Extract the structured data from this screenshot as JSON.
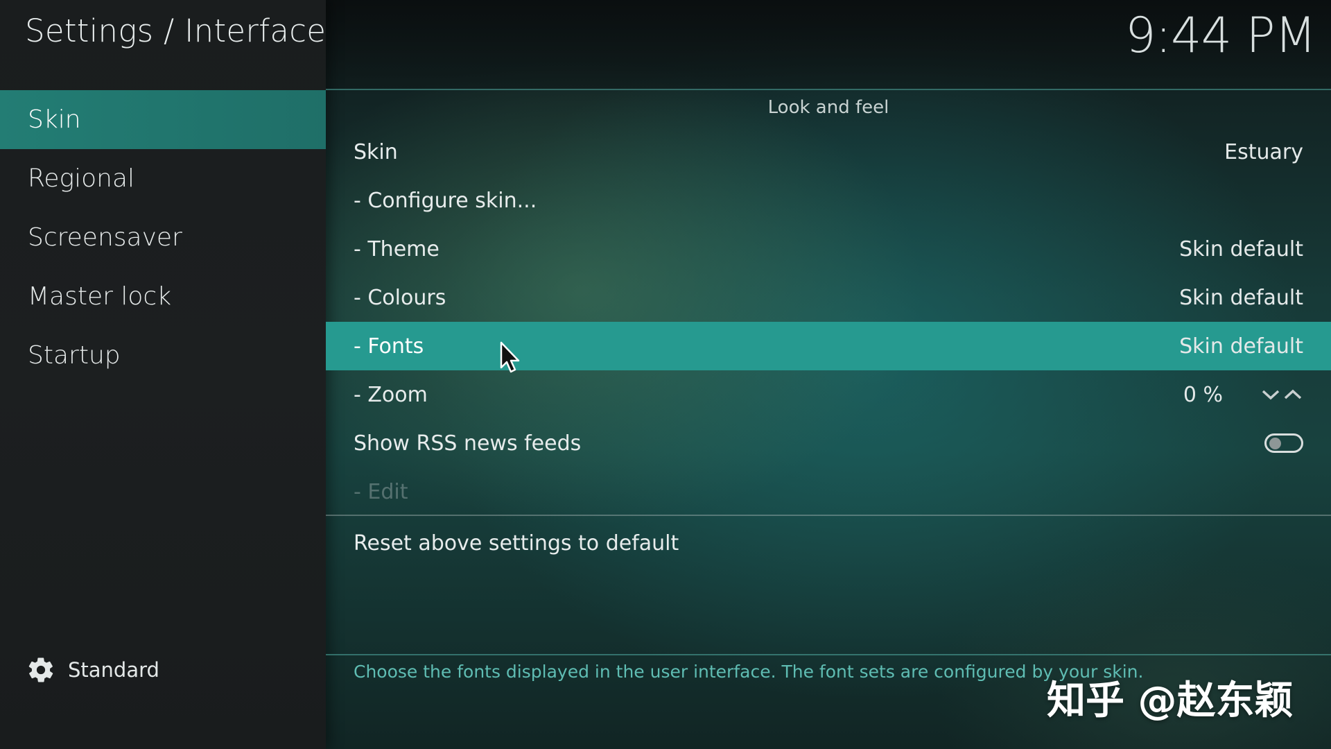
{
  "header": {
    "title": "Settings / Interface",
    "clock": "9:44 PM"
  },
  "sidebar": {
    "items": [
      {
        "label": "Skin",
        "active": true
      },
      {
        "label": "Regional"
      },
      {
        "label": "Screensaver"
      },
      {
        "label": "Master lock"
      },
      {
        "label": "Startup"
      }
    ],
    "footer": {
      "label": "Standard",
      "icon": "gear-icon"
    }
  },
  "main": {
    "section_header": "Look and feel",
    "rows": [
      {
        "label": "Skin",
        "value": "Estuary"
      },
      {
        "label": "- Configure skin...",
        "value": ""
      },
      {
        "label": "- Theme",
        "value": "Skin default"
      },
      {
        "label": "- Colours",
        "value": "Skin default"
      },
      {
        "label": "- Fonts",
        "value": "Skin default",
        "selected": true
      },
      {
        "label": "- Zoom",
        "value": "0 %",
        "controls": [
          "chevron-down-icon",
          "chevron-up-icon"
        ]
      },
      {
        "label": "Show RSS news feeds",
        "toggle": false
      },
      {
        "label": "- Edit",
        "disabled": true
      }
    ],
    "reset_label": "Reset above settings to default",
    "help_text": "Choose the fonts displayed in the user interface. The font sets are configured by your skin."
  },
  "watermark": "知乎 @赵东颖",
  "colors": {
    "accent": "#269a90",
    "sidebar_active": "#237d74",
    "help_text": "#5fbdb3"
  }
}
